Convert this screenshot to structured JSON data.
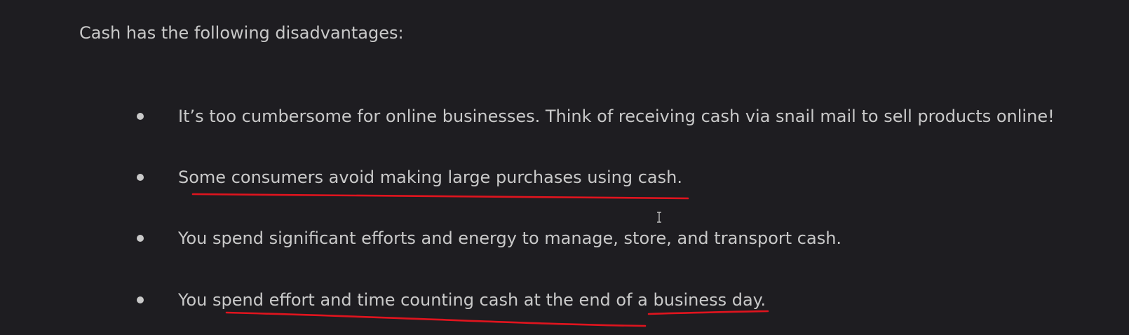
{
  "document": {
    "intro_text": "Cash has the following disadvantages:",
    "bullets": [
      {
        "text": "It’s too cumbersome for online businesses. Think of receiving cash via snail mail to sell products online!"
      },
      {
        "text": "Some consumers avoid making large purchases using cash."
      },
      {
        "text": "You spend significant efforts and energy to manage, store, and transport cash."
      },
      {
        "text": "You spend effort and time counting cash at the end of a business day."
      }
    ]
  },
  "annotations": {
    "underline_color": "#e0141e"
  },
  "cursor": {
    "icon": "i-beam-text-cursor-icon"
  },
  "theme": {
    "background": "#1e1d21",
    "text": "#c9c9c9"
  }
}
